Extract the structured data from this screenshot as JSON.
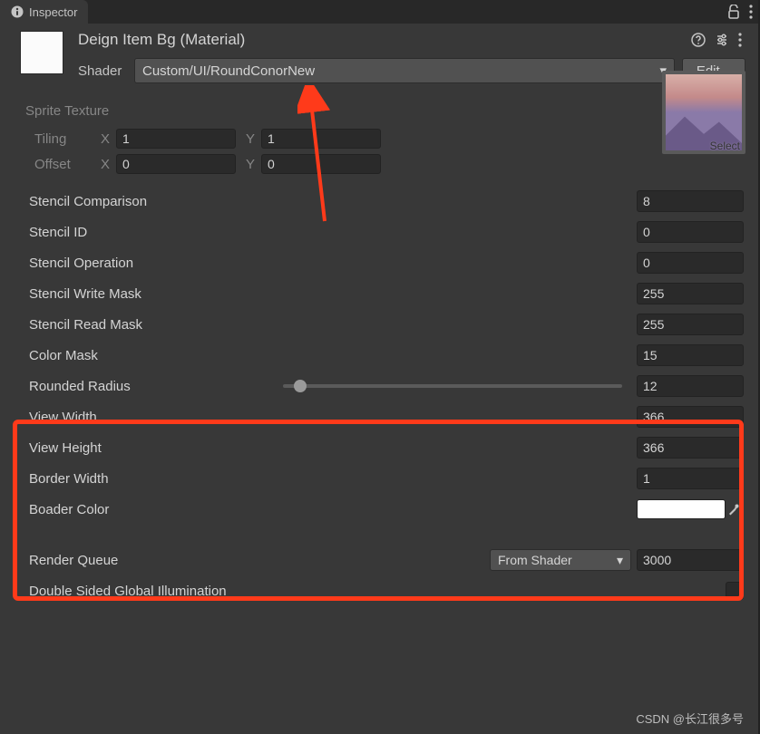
{
  "tab": {
    "title": "Inspector"
  },
  "header": {
    "title": "Deign Item Bg (Material)",
    "shader_label": "Shader",
    "shader_value": "Custom/UI/RoundConorNew",
    "edit_label": "Edit..."
  },
  "sprite": {
    "section": "Sprite Texture",
    "tiling_label": "Tiling",
    "offset_label": "Offset",
    "x_label": "X",
    "y_label": "Y",
    "tiling_x": "1",
    "tiling_y": "1",
    "offset_x": "0",
    "offset_y": "0",
    "select": "Select"
  },
  "props": {
    "stencil_comparison": {
      "label": "Stencil Comparison",
      "value": "8"
    },
    "stencil_id": {
      "label": "Stencil ID",
      "value": "0"
    },
    "stencil_operation": {
      "label": "Stencil Operation",
      "value": "0"
    },
    "stencil_write_mask": {
      "label": "Stencil Write Mask",
      "value": "255"
    },
    "stencil_read_mask": {
      "label": "Stencil Read Mask",
      "value": "255"
    },
    "color_mask": {
      "label": "Color Mask",
      "value": "15"
    },
    "rounded_radius": {
      "label": "Rounded Radius",
      "value": "12",
      "slider_pct": 5
    },
    "view_width": {
      "label": "View Width",
      "value": "366"
    },
    "view_height": {
      "label": "View Height",
      "value": "366"
    },
    "border_width": {
      "label": "Border Width",
      "value": "1"
    },
    "boader_color": {
      "label": "Boader Color",
      "color": "#ffffff"
    }
  },
  "render_queue": {
    "label": "Render Queue",
    "mode": "From Shader",
    "value": "3000"
  },
  "double_sided": {
    "label": "Double Sided Global Illumination",
    "checked": false
  },
  "watermark": "CSDN @长江很多号"
}
